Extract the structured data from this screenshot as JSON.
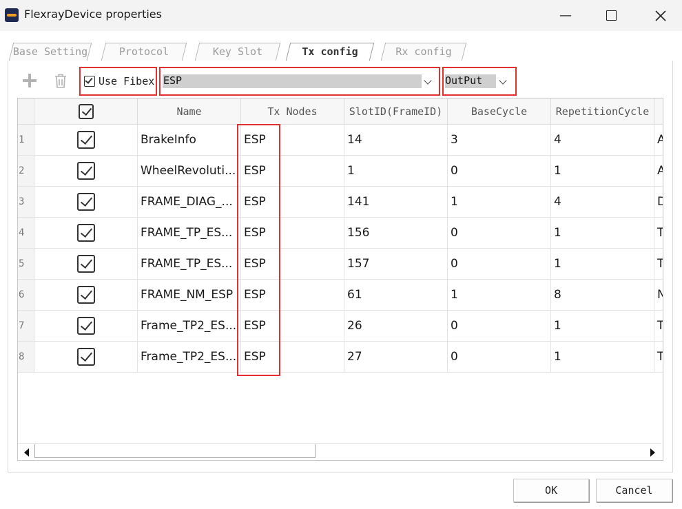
{
  "window": {
    "title": "FlexrayDevice properties",
    "minimize_glyph": "—"
  },
  "tabs": [
    {
      "label": "Base Setting",
      "active": false
    },
    {
      "label": "Protocol",
      "active": false
    },
    {
      "label": "Key Slot",
      "active": false
    },
    {
      "label": "Tx config",
      "active": true
    },
    {
      "label": "Rx config",
      "active": false
    }
  ],
  "toolbar": {
    "add_icon": "plus-icon",
    "delete_icon": "trash-icon",
    "use_fibex_label": "Use Fibex",
    "use_fibex_checked": true,
    "node_select_value": "ESP",
    "direction_select_value": "OutPut"
  },
  "table": {
    "columns": [
      "",
      "Name",
      "Tx Nodes",
      "SlotID(FrameID)",
      "BaseCycle",
      "RepetitionCycle"
    ],
    "rows": [
      {
        "num": "1",
        "checked": true,
        "name": "BrakeInfo",
        "tx_nodes": "ESP",
        "slot_id": "14",
        "base_cycle": "3",
        "rep_cycle": "4",
        "extra": "A"
      },
      {
        "num": "2",
        "checked": true,
        "name": "WheelRevoluti...",
        "tx_nodes": "ESP",
        "slot_id": "1",
        "base_cycle": "0",
        "rep_cycle": "1",
        "extra": "A"
      },
      {
        "num": "3",
        "checked": true,
        "name": "FRAME_DIAG_...",
        "tx_nodes": "ESP",
        "slot_id": "141",
        "base_cycle": "1",
        "rep_cycle": "4",
        "extra": "D"
      },
      {
        "num": "4",
        "checked": true,
        "name": "FRAME_TP_ES...",
        "tx_nodes": "ESP",
        "slot_id": "156",
        "base_cycle": "0",
        "rep_cycle": "1",
        "extra": "T"
      },
      {
        "num": "5",
        "checked": true,
        "name": "FRAME_TP_ES...",
        "tx_nodes": "ESP",
        "slot_id": "157",
        "base_cycle": "0",
        "rep_cycle": "1",
        "extra": "T"
      },
      {
        "num": "6",
        "checked": true,
        "name": "FRAME_NM_ESP",
        "tx_nodes": "ESP",
        "slot_id": "61",
        "base_cycle": "1",
        "rep_cycle": "8",
        "extra": "N"
      },
      {
        "num": "7",
        "checked": true,
        "name": "Frame_TP2_ES...",
        "tx_nodes": "ESP",
        "slot_id": "26",
        "base_cycle": "0",
        "rep_cycle": "1",
        "extra": "T"
      },
      {
        "num": "8",
        "checked": true,
        "name": "Frame_TP2_ES...",
        "tx_nodes": "ESP",
        "slot_id": "27",
        "base_cycle": "0",
        "rep_cycle": "1",
        "extra": "T"
      }
    ]
  },
  "buttons": {
    "ok": "OK",
    "cancel": "Cancel"
  },
  "colors": {
    "highlight": "#e53030",
    "combo_bg": "#cfcfcf"
  }
}
